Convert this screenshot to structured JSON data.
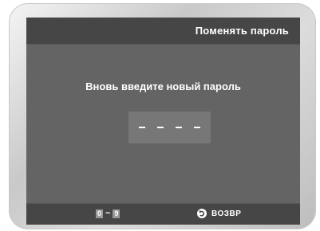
{
  "header": {
    "title": "Поменять пароль"
  },
  "main": {
    "prompt": "Вновь введите новый пароль",
    "password_placeholder": "- - - -"
  },
  "footer": {
    "key_from": "0",
    "key_separator": "~",
    "key_to": "9",
    "return_label": "ВОЗВР",
    "return_icon": "return-arrow-icon"
  }
}
